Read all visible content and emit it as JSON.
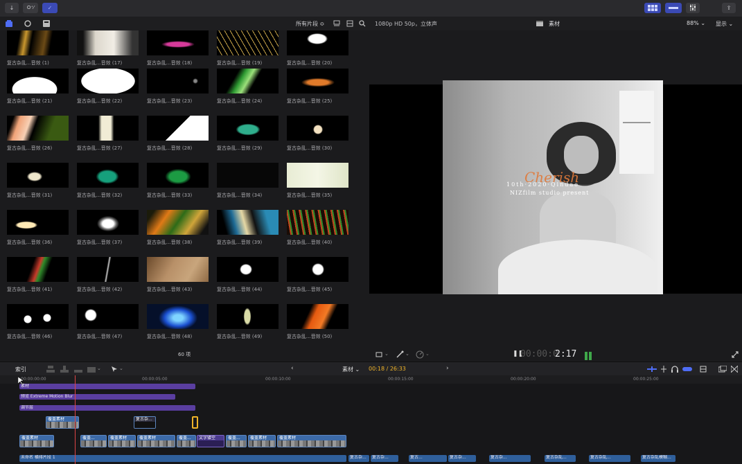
{
  "toolbar": {
    "import_label": "↓",
    "keywords_label": "O⁺⁄",
    "check_label": "✓",
    "share_label": "⇪"
  },
  "browser": {
    "filter_label": "所有片段 ≎",
    "count_label": "60 项",
    "clips": [
      {
        "label": "复古杂乱...音效 (1)"
      },
      {
        "label": "复古杂乱...音效 (17)"
      },
      {
        "label": "复古杂乱...音效 (18)"
      },
      {
        "label": "复古杂乱...音效 (19)"
      },
      {
        "label": "复古杂乱...音效 (20)"
      },
      {
        "label": "复古杂乱...音效 (21)"
      },
      {
        "label": "复古杂乱...音效 (22)"
      },
      {
        "label": "复古杂乱...音效 (23)"
      },
      {
        "label": "复古杂乱...音效 (24)"
      },
      {
        "label": "复古杂乱...音效 (25)"
      },
      {
        "label": "复古杂乱...音效 (26)"
      },
      {
        "label": "复古杂乱...音效 (27)"
      },
      {
        "label": "复古杂乱...音效 (28)"
      },
      {
        "label": "复古杂乱...音效 (29)"
      },
      {
        "label": "复古杂乱...音效 (30)"
      },
      {
        "label": "复古杂乱...音效 (31)"
      },
      {
        "label": "复古杂乱...音效 (32)"
      },
      {
        "label": "复古杂乱...音效 (33)"
      },
      {
        "label": "复古杂乱...音效 (34)"
      },
      {
        "label": "复古杂乱...音效 (35)"
      },
      {
        "label": "复古杂乱...音效 (36)"
      },
      {
        "label": "复古杂乱...音效 (37)"
      },
      {
        "label": "复古杂乱...音效 (38)"
      },
      {
        "label": "复古杂乱...音效 (39)"
      },
      {
        "label": "复古杂乱...音效 (40)"
      },
      {
        "label": "复古杂乱...音效 (41)"
      },
      {
        "label": "复古杂乱...音效 (42)"
      },
      {
        "label": "复古杂乱...音效 (43)"
      },
      {
        "label": "复古杂乱...音效 (44)"
      },
      {
        "label": "复古杂乱...音效 (45)"
      },
      {
        "label": "复古杂乱...音效 (46)"
      },
      {
        "label": "复古杂乱...音效 (47)"
      },
      {
        "label": "复古杂乱...音效 (48)"
      },
      {
        "label": "复古杂乱...音效 (49)"
      },
      {
        "label": "复古杂乱...音效 (50)"
      }
    ]
  },
  "viewer": {
    "format_label": "1080p HD 50p，立体声",
    "title": "素材",
    "zoom": "88% ⌄",
    "display_label": "显示 ⌄",
    "overlay_line1": "10th·2020·Qindao",
    "overlay_line2": "NIZfilm studio present",
    "overlay_script": "Cherish",
    "timecode": "00:00:02:17",
    "timecode_dim": "00:00:0",
    "timecode_bright": "2:17"
  },
  "timeline": {
    "index_label": "索引",
    "project_label": "素材 ⌄",
    "position": "00:18 / 26:33",
    "ruler_ticks": [
      "00:00:00:00",
      "00:00:05:00",
      "00:00:10:00",
      "00:00:15:00",
      "00:00:20:00",
      "00:00:25:00"
    ],
    "bars": [
      {
        "label": "素材"
      },
      {
        "label": "预览 Extreme Motion Blur"
      },
      {
        "label": "调节层"
      }
    ],
    "connected_clips": [
      {
        "label": "覆盖素材"
      },
      {
        "label": "复古杂..."
      }
    ],
    "primary_clips": [
      {
        "label": "覆盖素材"
      },
      {
        "label": "覆盖..."
      },
      {
        "label": "覆盖素材"
      },
      {
        "label": "覆盖素材"
      },
      {
        "label": "覆盖..."
      },
      {
        "label": "文字镂空"
      },
      {
        "label": "覆盖..."
      },
      {
        "label": "覆盖素材"
      },
      {
        "label": "覆盖素材"
      }
    ],
    "audio_main": "未命名 横排片段 1",
    "audio_clips": [
      "复古杂...",
      "复古杂...",
      "复古...",
      "复古杂...",
      "复古杂...",
      "复古杂乱...",
      "复古杂乱...",
      "复古杂乱模糊..."
    ]
  }
}
